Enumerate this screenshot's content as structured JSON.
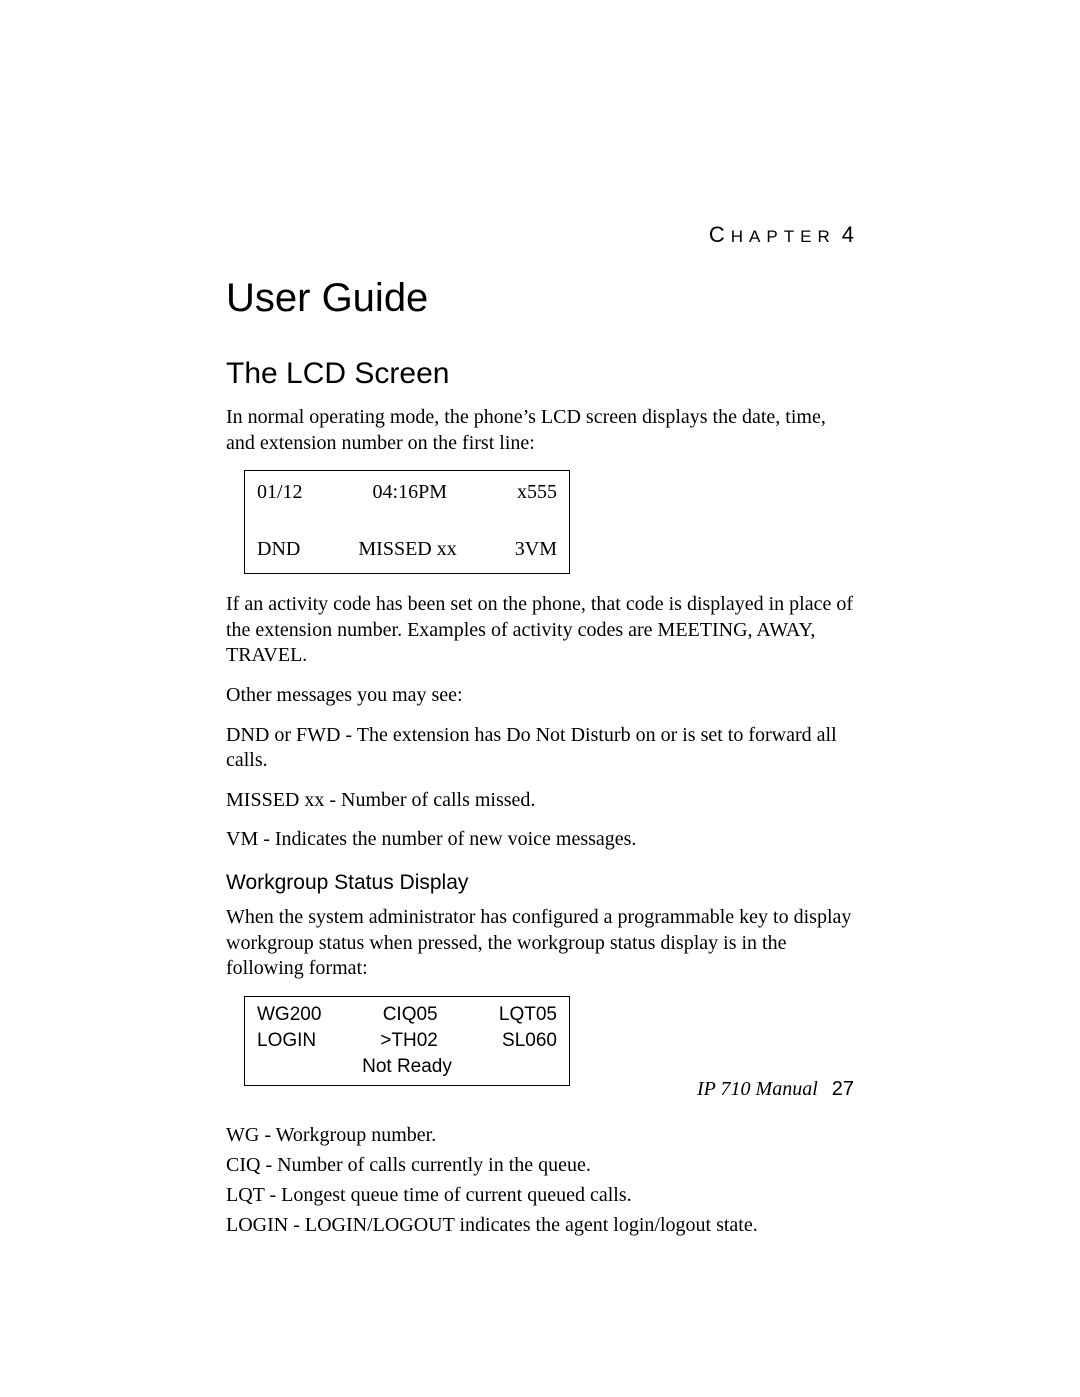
{
  "chapter": {
    "label_cap": "C",
    "label_rest": "HAPTER",
    "number": "4"
  },
  "title": "User Guide",
  "section": "The LCD Screen",
  "intro": "In normal operating mode, the phone’s LCD screen displays the date, time, and extension number on the first line:",
  "lcd": {
    "row1": {
      "left": "01/12",
      "center": "04:16PM",
      "right": "x555"
    },
    "row2": {
      "left": "DND",
      "center": "MISSED xx",
      "right": "3VM"
    }
  },
  "after_lcd": "If an activity code has been set on the phone, that code is displayed in place of the extension number. Examples of activity codes are MEETING, AWAY, TRAVEL.",
  "other_msg_intro": "Other messages you may see:",
  "msg_dnd": "DND or FWD - The extension has Do Not Disturb on or is set to forward all calls.",
  "msg_missed": "MISSED xx - Number of calls missed.",
  "msg_vm": "VM - Indicates the number of new voice messages.",
  "subsection": "Workgroup Status Display",
  "wg_intro": "When the system administrator has configured a programmable key to display workgroup status when pressed, the workgroup status display is in the following format:",
  "wg_box": {
    "row1": {
      "left": "WG200",
      "center": "CIQ05",
      "right": "LQT05"
    },
    "row2": {
      "left": "LOGIN",
      "center": ">TH02",
      "right": "SL060"
    },
    "row3": "Not Ready"
  },
  "defs": {
    "wg": "WG - Workgroup number.",
    "ciq": "CIQ - Number of calls currently in the queue.",
    "lqt": "LQT - Longest queue time of current queued calls.",
    "login": "LOGIN - LOGIN/LOGOUT indicates the agent login/logout state."
  },
  "footer": {
    "manual": "IP 710 Manual",
    "page": "27"
  }
}
